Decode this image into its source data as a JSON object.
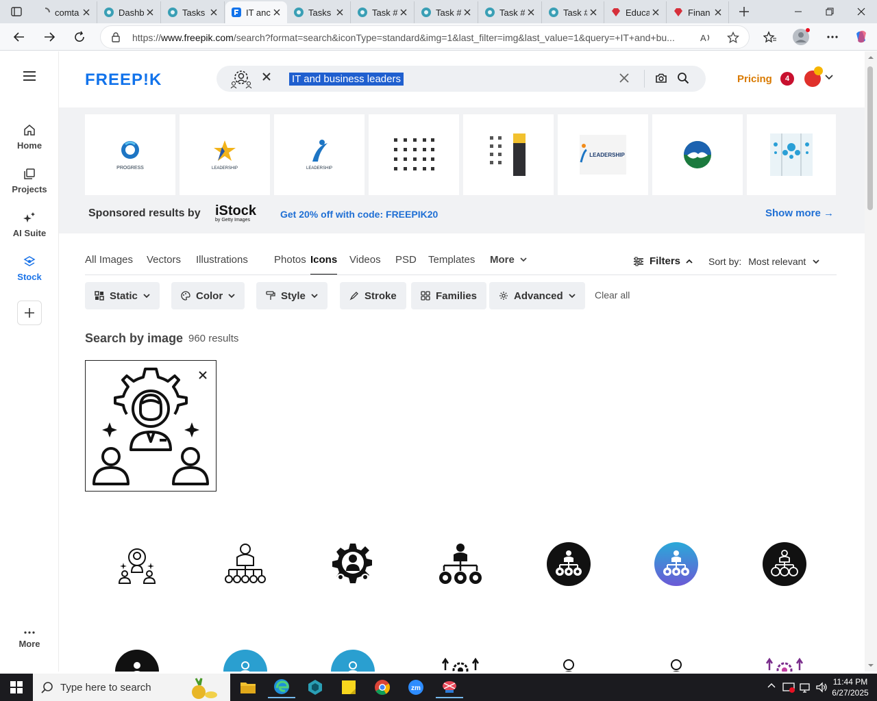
{
  "browser": {
    "tabs": [
      {
        "label": "comta",
        "icon": "loading-icon",
        "active": false
      },
      {
        "label": "Dashb",
        "icon": "app-icon",
        "active": false
      },
      {
        "label": "Tasks",
        "icon": "app-icon",
        "active": false
      },
      {
        "label": "IT anc",
        "icon": "freepik-icon",
        "active": true
      },
      {
        "label": "Tasks",
        "icon": "app-icon",
        "active": false
      },
      {
        "label": "Task #",
        "icon": "app-icon",
        "active": false
      },
      {
        "label": "Task #",
        "icon": "app-icon",
        "active": false
      },
      {
        "label": "Task #",
        "icon": "app-icon",
        "active": false
      },
      {
        "label": "Task #",
        "icon": "app-icon",
        "active": false
      },
      {
        "label": "Educa",
        "icon": "gem-icon",
        "active": false
      },
      {
        "label": "Finan",
        "icon": "gem-icon",
        "active": false
      }
    ],
    "url_prefix": "https://",
    "url_domain": "www.freepik.com",
    "url_rest": "/search?format=search&iconType=standard&img=1&last_filter=img&last_value=1&query=+IT+and+bu..."
  },
  "sidebar": {
    "items": [
      {
        "label": "Home",
        "icon": "home-icon"
      },
      {
        "label": "Projects",
        "icon": "projects-icon"
      },
      {
        "label": "AI Suite",
        "icon": "sparkle-icon"
      },
      {
        "label": "Stock",
        "icon": "stock-icon"
      }
    ],
    "more_label": "More"
  },
  "header": {
    "logo": "FREEP!K",
    "search_query": "IT and business leaders",
    "pricing": "Pricing",
    "notification_count": "4"
  },
  "sponsored": {
    "thumb_texts": [
      "PROGRESS",
      "LEADERSHIP",
      "LEADERSHIP",
      "",
      "",
      "LEADERSHIP",
      "",
      ""
    ],
    "by_label": "Sponsored results by",
    "brand": "iStock",
    "brand_sub": "by Getty Images",
    "promo": "Get 20% off with code: FREEPIK20",
    "show_more": "Show more →"
  },
  "type_tabs": [
    "All Images",
    "Vectors",
    "Illustrations",
    "Photos",
    "Icons",
    "Videos",
    "PSD",
    "Templates",
    "More"
  ],
  "active_type_tab": "Icons",
  "filters_label": "Filters",
  "sort": {
    "label": "Sort by:",
    "value": "Most relevant"
  },
  "chips": [
    "Static",
    "Color",
    "Style",
    "Stroke",
    "Families",
    "Advanced"
  ],
  "clear_all": "Clear all",
  "search_by_image": {
    "title": "Search by image",
    "count": "960 results"
  },
  "taskbar": {
    "search_placeholder": "Type here to search",
    "time": "11:44 PM",
    "date": "6/27/2025"
  },
  "colors": {
    "brand_blue": "#1273eb",
    "pricing_orange": "#d97a00",
    "link_blue": "#1f6fd4"
  }
}
